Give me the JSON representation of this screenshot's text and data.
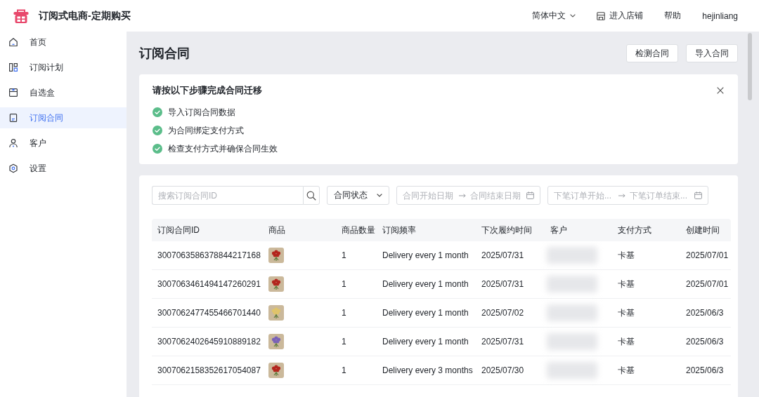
{
  "app": {
    "title": "订阅式电商-定期购买"
  },
  "top_nav": {
    "language": "简体中文",
    "store_link": "进入店铺",
    "help": "帮助",
    "user": "hejinliang"
  },
  "sidebar": {
    "items": [
      {
        "label": "首页",
        "selected": false
      },
      {
        "label": "订阅计划",
        "selected": false
      },
      {
        "label": "自选盒",
        "selected": false
      },
      {
        "label": "订阅合同",
        "selected": true
      },
      {
        "label": "客户",
        "selected": false
      },
      {
        "label": "设置",
        "selected": false
      }
    ]
  },
  "page": {
    "title": "订阅合同",
    "actions": [
      "检测合同",
      "导入合同"
    ]
  },
  "migration_steps": {
    "title": "请按以下步骤完成合同迁移",
    "steps": [
      {
        "label": "导入订阅合同数据",
        "done": true
      },
      {
        "label": "为合同绑定支付方式",
        "done": true
      },
      {
        "label": "检查支付方式并确保合同生效",
        "done": true
      }
    ]
  },
  "filters": {
    "search": {
      "placeholder": "搜索订阅合同ID"
    },
    "status": {
      "value": "合同状态"
    },
    "contract_dates": {
      "start_placeholder": "合同开始日期",
      "end_placeholder": "合同结束日期"
    },
    "order_dates": {
      "start_placeholder": "下笔订单开始...",
      "end_placeholder": "下笔订单结束..."
    }
  },
  "table": {
    "columns": [
      "订阅合同ID",
      "商品",
      "商品数量",
      "订阅频率",
      "下次履约时间",
      "客户",
      "支付方式",
      "创建时间"
    ],
    "rows": [
      {
        "id": "3007063586378844217168",
        "photo": {
          "color": "#b3261e"
        },
        "quantity": "1",
        "frequency": "Delivery every 1 month",
        "next_date": "2025/07/31",
        "customer_blurred": true,
        "payment": "卡基",
        "created": "2025/07/01"
      },
      {
        "id": "3007063461494147260291",
        "photo": {
          "color": "#b3261e"
        },
        "quantity": "1",
        "frequency": "Delivery every 1 month",
        "next_date": "2025/07/31",
        "customer_blurred": true,
        "payment": "卡基",
        "created": "2025/07/01"
      },
      {
        "id": "3007062477455466701440",
        "photo": {
          "color": "#e0c46a"
        },
        "quantity": "1",
        "frequency": "Delivery every 1 month",
        "next_date": "2025/07/02",
        "customer_blurred": true,
        "payment": "卡基",
        "created": "2025/06/3"
      },
      {
        "id": "3007062402645910889182",
        "photo": {
          "color": "#7a62b8"
        },
        "quantity": "1",
        "frequency": "Delivery every 1 month",
        "next_date": "2025/07/31",
        "customer_blurred": true,
        "payment": "卡基",
        "created": "2025/06/3"
      },
      {
        "id": "3007062158352617054087",
        "photo": {
          "color": "#b3261e"
        },
        "quantity": "1",
        "frequency": "Delivery every 3 months",
        "next_date": "2025/07/30",
        "customer_blurred": true,
        "payment": "卡基",
        "created": "2025/06/3"
      }
    ]
  }
}
